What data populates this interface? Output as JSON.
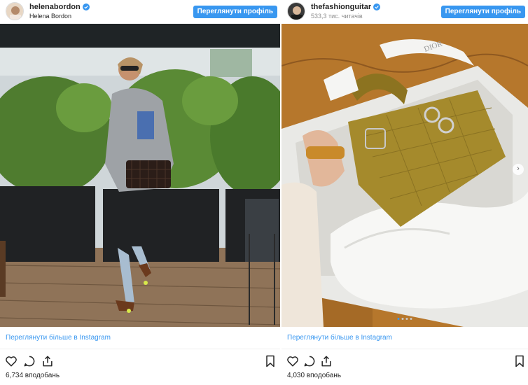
{
  "posts": [
    {
      "username": "helenabordon",
      "subtitle": "Helena Bordon",
      "view_profile": "Переглянути профіль",
      "view_more": "Переглянути більше в Instagram",
      "likes": "6,734 вподобань",
      "icons": [
        "heart-icon",
        "comment-icon",
        "share-icon",
        "bookmark-icon",
        "verified-icon"
      ]
    },
    {
      "username": "thefashionguitar",
      "subtitle": "533,3 тис. читачів",
      "view_profile": "Переглянути профіль",
      "view_more": "Переглянути більше в Instagram",
      "likes": "4,030 вподобань",
      "carousel_count": 4,
      "carousel_active": 1,
      "icons": [
        "heart-icon",
        "comment-icon",
        "share-icon",
        "bookmark-icon",
        "verified-icon",
        "next-arrow-icon"
      ]
    }
  ],
  "colors": {
    "accent": "#3897f0",
    "text": "#262626",
    "muted": "#8e8e8e",
    "verified": "#3897f0"
  }
}
